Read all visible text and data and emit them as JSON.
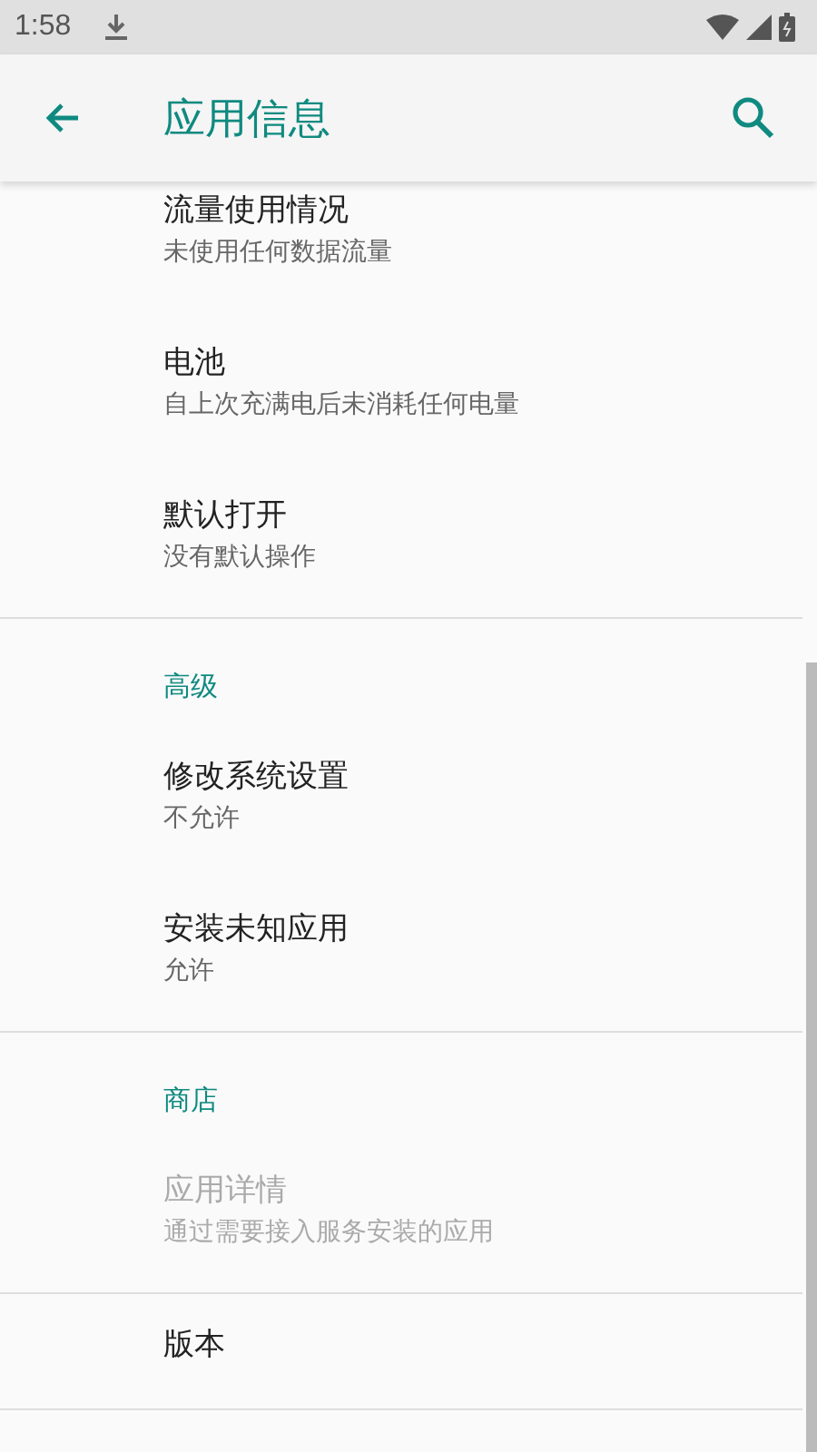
{
  "status_bar": {
    "time": "1:58"
  },
  "app_bar": {
    "title": "应用信息"
  },
  "sections": [
    {
      "items": [
        {
          "title": "流量使用情况",
          "summary": "未使用任何数据流量",
          "disabled": false
        },
        {
          "title": "电池",
          "summary": "自上次充满电后未消耗任何电量",
          "disabled": false
        },
        {
          "title": "默认打开",
          "summary": "没有默认操作",
          "disabled": false
        }
      ]
    },
    {
      "header": "高级",
      "items": [
        {
          "title": "修改系统设置",
          "summary": "不允许",
          "disabled": false
        },
        {
          "title": "安装未知应用",
          "summary": "允许",
          "disabled": false
        }
      ]
    },
    {
      "header": "商店",
      "items": [
        {
          "title": "应用详情",
          "summary": "通过需要接入服务安装的应用",
          "disabled": true
        }
      ]
    },
    {
      "items": [
        {
          "title": "版本",
          "disabled": false
        }
      ]
    }
  ]
}
